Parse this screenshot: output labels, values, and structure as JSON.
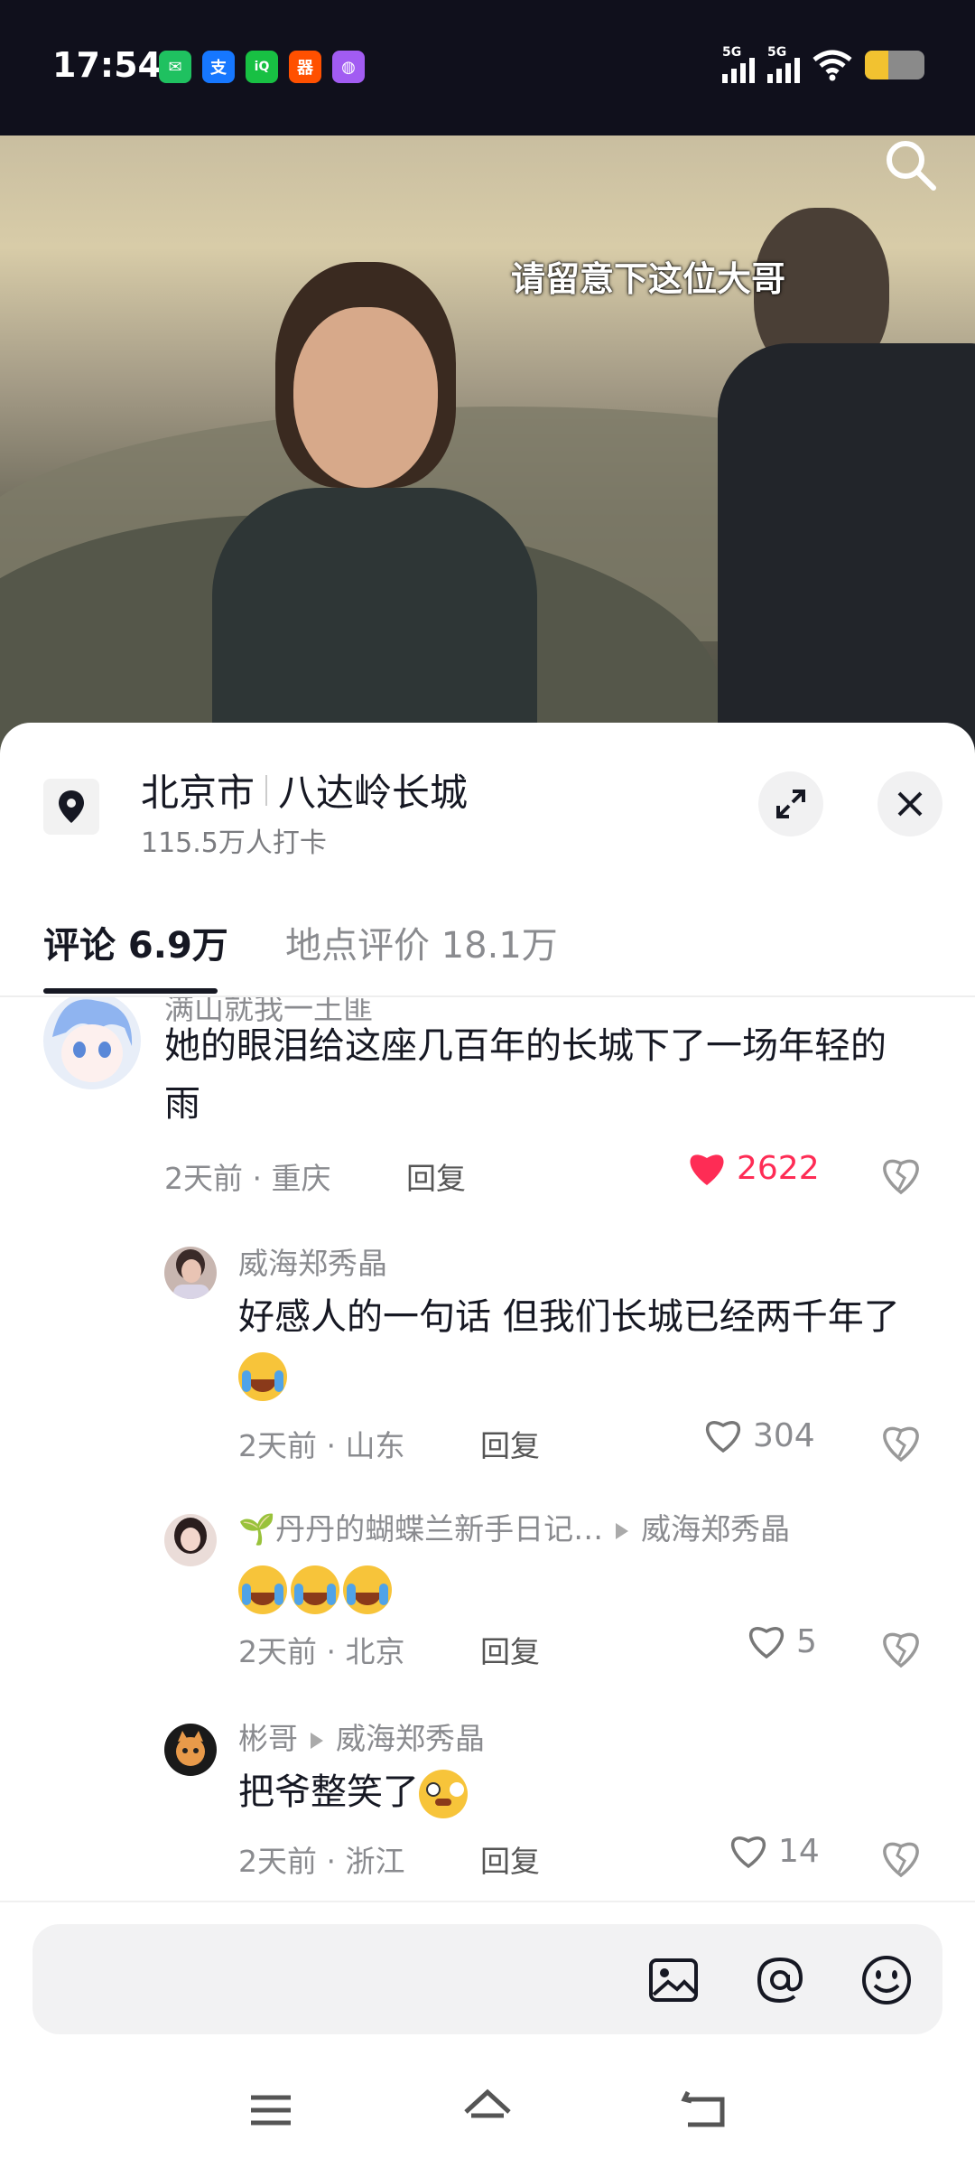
{
  "status_bar": {
    "time": "17:54",
    "apps": [
      {
        "name": "wechat-icon",
        "color": "#1fc160",
        "glyph": "✉"
      },
      {
        "name": "alipay-icon",
        "color": "#1677ff",
        "glyph": "支"
      },
      {
        "name": "iqiyi-icon",
        "color": "#18c043",
        "glyph": "iQ"
      },
      {
        "name": "taobao-icon",
        "color": "#ff5000",
        "glyph": "器"
      },
      {
        "name": "app-icon",
        "color": "#a25cf2",
        "glyph": "◍"
      }
    ],
    "signal_tags": [
      "5G",
      "5G"
    ],
    "battery_level": 0.4
  },
  "video": {
    "subtitle": "请留意下这位大哥"
  },
  "location": {
    "city": "北京市",
    "place": "八达岭长城",
    "checkins": "115.5万人打卡"
  },
  "tabs": [
    {
      "label": "评论 6.9万",
      "active": true
    },
    {
      "label": "地点评价 18.1万",
      "active": false
    }
  ],
  "comments": {
    "c1": {
      "name": "满山就我一土匪",
      "text": "她的眼泪给这座几百年的长城下了一场年轻的雨",
      "meta": "2天前 · 重庆",
      "reply": "回复",
      "likes": "2622"
    },
    "c2": {
      "name": "威海郑秀晶",
      "text": "好感人的一句话 但我们长城已经两千年了",
      "meta": "2天前 · 山东",
      "reply": "回复",
      "likes": "304"
    },
    "c3": {
      "name": "🌱丹丹的蝴蝶兰新手日记…",
      "reply_to": "威海郑秀晶",
      "meta": "2天前 · 北京",
      "reply": "回复",
      "likes": "5"
    },
    "c4": {
      "name": "彬哥",
      "reply_to": "威海郑秀晶",
      "text": "把爷整笑了",
      "meta": "2天前 · 浙江",
      "reply": "回复",
      "likes": "14"
    }
  },
  "colors": {
    "accent": "#fe2c55",
    "text": "#161823",
    "secondary": "#8a8b8f"
  }
}
